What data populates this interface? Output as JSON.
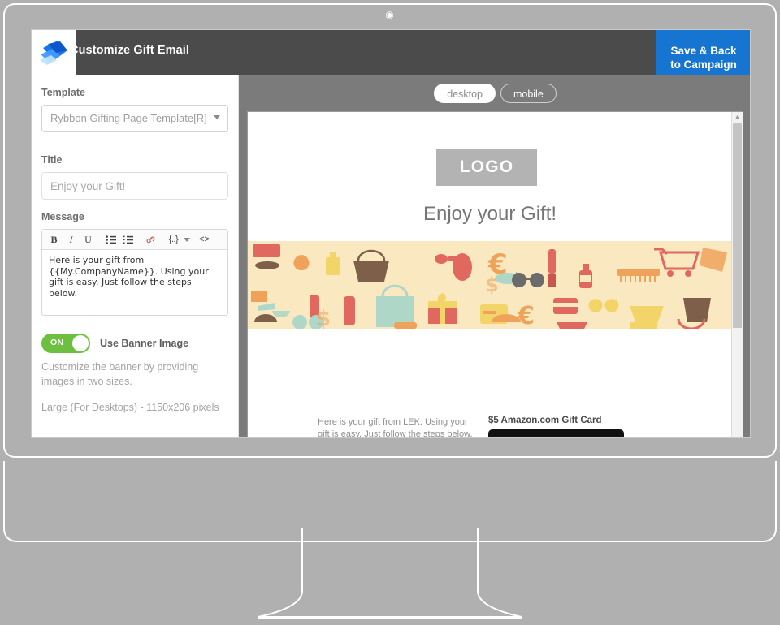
{
  "monitor": {
    "camera_icon": "camera-icon"
  },
  "app": {
    "logo_icon": "rybbon-logo-icon",
    "header_title": "Customize Gift Email",
    "save_button": "Save & Back\nto Campaign",
    "save_button_line1": "Save & Back",
    "save_button_line2": "to Campaign"
  },
  "sidebar": {
    "template": {
      "label": "Template",
      "value": "Rybbon Gifting Page Template[R]",
      "caret_icon": "chevron-down-icon"
    },
    "title": {
      "label": "Title",
      "placeholder": "Enjoy your Gift!",
      "value": ""
    },
    "message": {
      "label": "Message",
      "toolbar": [
        {
          "name": "bold-icon",
          "glyph": "B"
        },
        {
          "name": "italic-icon",
          "glyph": "I"
        },
        {
          "name": "underline-icon",
          "glyph": "U"
        },
        {
          "name": "bullet-list-icon",
          "glyph": "☰"
        },
        {
          "name": "numbered-list-icon",
          "glyph": "☷"
        },
        {
          "name": "link-icon",
          "glyph": "🔗"
        },
        {
          "name": "merge-tag-icon",
          "glyph": "{..}"
        },
        {
          "name": "source-code-icon",
          "glyph": "<>"
        }
      ],
      "body": "Here is your gift from {{My.CompanyName}}. Using your gift is easy. Just follow the steps below."
    },
    "banner_toggle": {
      "state": "ON",
      "label": "Use Banner Image",
      "help_line": "Customize the banner by providing images in two sizes.",
      "size_note": "Large (For Desktops) - 1150x206 pixels"
    }
  },
  "preview": {
    "tabs": [
      {
        "label": "desktop",
        "active": true
      },
      {
        "label": "mobile",
        "active": false
      }
    ],
    "scroll_up_icon": "scroll-up-arrow-icon",
    "logo_text": "LOGO",
    "title": "Enjoy your Gift!",
    "banner_alt": "shopping-items-pattern-banner",
    "body_text": "Here is your gift from LEK. Using your gift is easy. Just follow the steps below.",
    "gift_title": "$5 Amazon.com Gift Card"
  },
  "colors": {
    "accent_blue": "#1675d1",
    "header_gray": "#4b4b4b",
    "toggle_green": "#6cbf3f",
    "preview_panel_gray": "#7b7b7b",
    "banner_cream": "#fae9c0",
    "banner_coral": "#e0685f",
    "banner_teal": "#aed7c8",
    "banner_brown": "#7d5f4a",
    "banner_yellow": "#f3d469",
    "banner_orange": "#efa25a"
  }
}
